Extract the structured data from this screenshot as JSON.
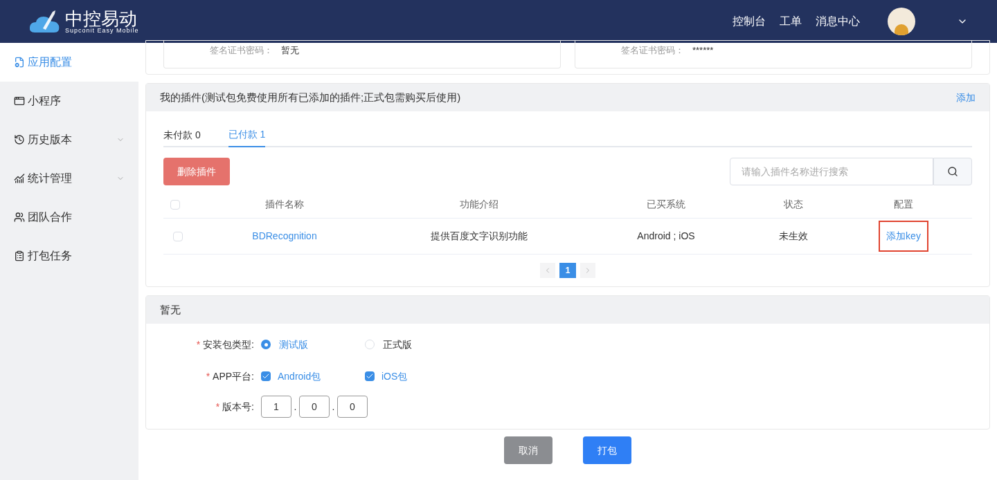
{
  "header": {
    "logo": {
      "title": "中控易动",
      "subtitle": "Supconit Easy Mobile"
    },
    "nav": [
      "控制台",
      "工单",
      "消息中心"
    ]
  },
  "sidebar": {
    "items": [
      {
        "label": "应用配置",
        "selected": true,
        "expandable": false
      },
      {
        "label": "小程序",
        "selected": false,
        "expandable": false
      },
      {
        "label": "历史版本",
        "selected": false,
        "expandable": true
      },
      {
        "label": "统计管理",
        "selected": false,
        "expandable": true
      },
      {
        "label": "团队合作",
        "selected": false,
        "expandable": false
      },
      {
        "label": "打包任务",
        "selected": false,
        "expandable": false
      }
    ]
  },
  "cert_cards": [
    {
      "label": "签名证书密码：",
      "value": "暂无"
    },
    {
      "label": "签名证书密码：",
      "value": "******"
    }
  ],
  "plugins": {
    "title": "我的插件(测试包免费使用所有已添加的插件;正式包需购买后使用)",
    "add_link": "添加",
    "tabs": [
      {
        "label": "未付款 0",
        "selected": false
      },
      {
        "label": "已付款 1",
        "selected": true
      }
    ],
    "delete_button": "删除插件",
    "search": {
      "placeholder": "请输入插件名称进行搜索"
    },
    "select_all_checked": false,
    "columns": [
      "插件名称",
      "功能介绍",
      "已买系统",
      "状态",
      "配置"
    ],
    "rows": [
      {
        "checked": false,
        "name": "BDRecognition",
        "description": "提供百度文字识别功能",
        "systems": "Android ; iOS",
        "status": "未生效",
        "action": "添加key",
        "highlighted": true
      }
    ],
    "pages": [
      {
        "label": "1",
        "selected": true
      }
    ]
  },
  "build": {
    "title": "暂无",
    "package_type": {
      "label": "安装包类型:",
      "required_mark": "*",
      "options": [
        {
          "label": "测试版",
          "selected": true
        },
        {
          "label": "正式版",
          "selected": false
        }
      ]
    },
    "platform": {
      "label": "APP平台:",
      "required_mark": "*",
      "options": [
        {
          "label": "Android包",
          "checked": true
        },
        {
          "label": "iOS包",
          "checked": true
        }
      ]
    },
    "version": {
      "label": "版本号:",
      "required_mark": "*",
      "parts": [
        "1",
        "0",
        "0"
      ],
      "separators": [
        ".",
        "."
      ]
    }
  },
  "buttons": {
    "cancel": "取消",
    "submit": "打包"
  }
}
